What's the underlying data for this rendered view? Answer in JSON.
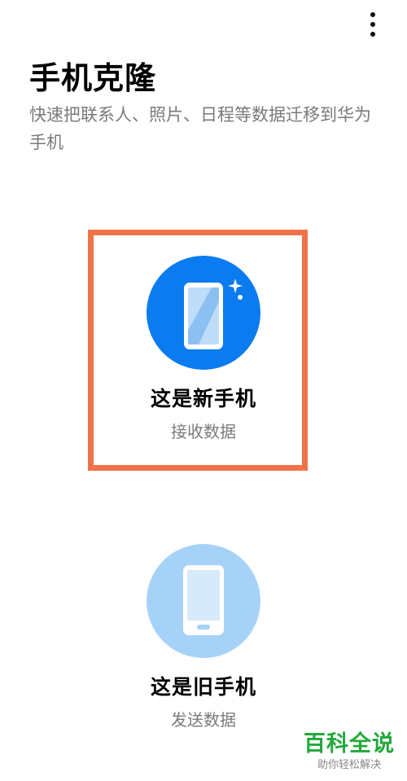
{
  "header": {
    "menu_icon": "more-vertical-icon"
  },
  "page": {
    "title": "手机克隆",
    "description": "快速把联系人、照片、日程等数据迁移到华为手机"
  },
  "options": {
    "new_phone": {
      "title": "这是新手机",
      "subtitle": "接收数据",
      "icon": "new-phone-icon",
      "color": "#0a7cf0"
    },
    "old_phone": {
      "title": "这是旧手机",
      "subtitle": "发送数据",
      "icon": "old-phone-icon",
      "color": "#a6d2f8"
    }
  },
  "annotation": {
    "highlight_color": "#f07348"
  },
  "watermark": {
    "title": "百科全说",
    "subtitle": "助你轻松解决"
  }
}
